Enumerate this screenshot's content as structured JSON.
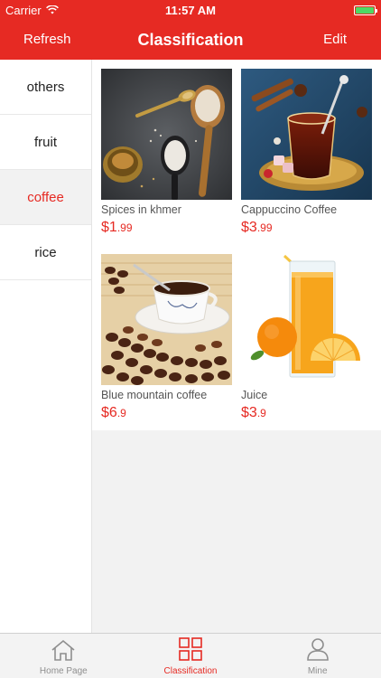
{
  "status": {
    "carrier": "Carrier",
    "time": "11:57 AM"
  },
  "nav": {
    "left_label": "Refresh",
    "title": "Classification",
    "right_label": "Edit"
  },
  "sidebar": {
    "items": [
      {
        "label": "others"
      },
      {
        "label": "fruit"
      },
      {
        "label": "coffee"
      },
      {
        "label": "rice"
      }
    ]
  },
  "products": [
    {
      "name": "Spices in khmer",
      "currency": "$",
      "price_int": "1",
      "price_dec": ".99"
    },
    {
      "name": "Cappuccino Coffee",
      "currency": "$",
      "price_int": "3",
      "price_dec": ".99"
    },
    {
      "name": "Blue mountain coffee",
      "currency": "$",
      "price_int": "6",
      "price_dec": ".9"
    },
    {
      "name": "Juice",
      "currency": "$",
      "price_int": "3",
      "price_dec": ".9"
    }
  ],
  "tabbar": {
    "tabs": [
      {
        "label": "Home Page",
        "icon": "home-icon"
      },
      {
        "label": "Classification",
        "icon": "grid-icon"
      },
      {
        "label": "Mine",
        "icon": "person-icon"
      }
    ]
  },
  "colors": {
    "accent": "#e62a23",
    "inactive": "#8e8e8e",
    "background": "#f2f2f2"
  }
}
